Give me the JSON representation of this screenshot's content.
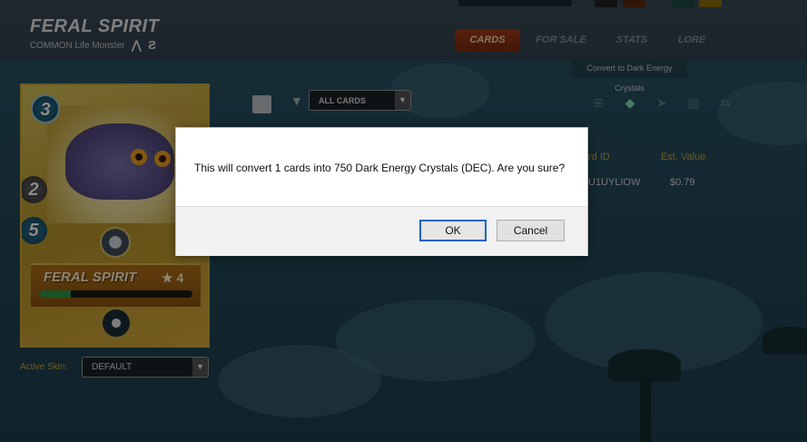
{
  "header": {
    "title": "FERAL SPIRIT",
    "subtitle": "COMMON Life Monster",
    "tabs": [
      {
        "label": "CARDS",
        "active": true
      },
      {
        "label": "FOR SALE",
        "active": false
      },
      {
        "label": "STATS",
        "active": false
      },
      {
        "label": "LORE",
        "active": false
      }
    ]
  },
  "card": {
    "mana": "3",
    "attack": "2",
    "health": "5",
    "name": "FERAL SPIRIT",
    "level": "★ 4",
    "xp_fraction": 0.2
  },
  "skin": {
    "label": "Active Skin:",
    "value": "DEFAULT"
  },
  "filter": {
    "value": "ALL CARDS"
  },
  "actions": {
    "tooltip": "Convert to Dark Energy Crystals",
    "icons": [
      "combine-icon",
      "dec-crystal-icon",
      "send-icon",
      "market-icon",
      "transfer-icon"
    ]
  },
  "table": {
    "headers": [
      "rd ID",
      "Est. Value"
    ],
    "rows": [
      [
        "U1UYLIOW",
        "$0.79"
      ]
    ]
  },
  "dialog": {
    "message": "This will convert 1 cards into 750 Dark Energy Crystals (DEC). Are you sure?",
    "ok_label": "OK",
    "cancel_label": "Cancel"
  },
  "colors": {
    "accent": "#c9a640",
    "active_tab": "#a63a18",
    "ok_border": "#0a64c4"
  }
}
